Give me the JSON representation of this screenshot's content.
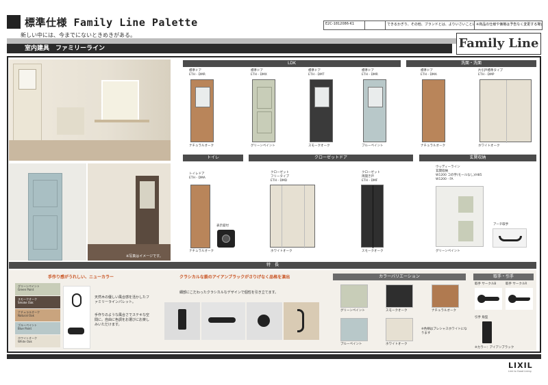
{
  "header": {
    "title": "標準仕様 Family Line Palette",
    "subtitle": "新しい中には、今までにないときめきがある。",
    "category": "室内建具　ファミリーライン",
    "logo": "Family Line",
    "info": [
      "E2C-1812086-K1",
      "",
      "できるかぎり、その他、ブランドとは、よりいさいことにも、写真の実際と、色調の異なる場合があります。",
      "※商品の仕様や価格は予告なく変更する場合があります。"
    ]
  },
  "photo": {
    "note": "※写真はイメージです。"
  },
  "sections": {
    "ldk": "LDK",
    "bath": "洗面・洗面",
    "toilet": "トイレ",
    "closet": "クローゼットドア",
    "entry": "玄関収納",
    "features": "特　長",
    "colors": "カラーバリエーション",
    "handles": "取手・引手"
  },
  "doors": [
    {
      "code": "標準ドア\nETH - DMR",
      "color": "ナチュラルオーク",
      "fill": "#b9855a"
    },
    {
      "code": "標準ドア\nETH - DMX",
      "color": "グリーンペイント",
      "fill": "#c8cdb8"
    },
    {
      "code": "標準ドア\nETH - DMT",
      "color": "スモークオーク",
      "fill": "#3a3a3a"
    },
    {
      "code": "標準ドア\nETH - DMR",
      "color": "ブルーペイント",
      "fill": "#b8c8c9"
    },
    {
      "code": "標準ドア\nETH - DMA",
      "color": "ナチュラルオーク",
      "fill": "#b9855a"
    },
    {
      "code": "片引戸標準タイプ\nETH - DMP",
      "color": "ホワイトオーク",
      "fill": "#e6e0d2"
    }
  ],
  "toilet": {
    "code": "トイレドア\nETH - DMA",
    "color": "ナチュラルオーク",
    "indicator": "表示錠付"
  },
  "closet": [
    {
      "code": "クローゼット\nフリータイプ\nETH - DMD",
      "color": "ホワイトオーク"
    },
    {
      "code": "クローゼット\n両開き戸\nETH - DMF",
      "color": "スモークオーク"
    }
  ],
  "entry": {
    "code": "ウッディーライン\n玄関収納\nW1200 コの字(モールなし)/H85\nW1200 - FA",
    "color": "グリーンペイント",
    "handle": "アーチ取手"
  },
  "features": {
    "left_title": "手作り感がうれしい、ニューカラー",
    "left_text1": "天然木の優しい風合感を活かしたファミリーラインパレット。",
    "left_text2": "手作りのような風合さでステキな空間に。自由に色調をお選びにお楽しみいただけます。",
    "swatches": [
      "グリーンペイント\nGreen Paint",
      "スモークオーク\nSmoke Oak",
      "ナチュラルオーク\nNatural Oak",
      "ブルーペイント\nBlue Paint",
      "ホワイトオーク\nWhite Oak"
    ],
    "mid_title": "クラシカルな鉄のアイアンブラックがさりげなく品格を演出",
    "mid_text": "細部にこだわったクラシカルなデザインで個性を引き立てます。"
  },
  "colors": {
    "items": [
      "グリーンペイント",
      "スモークオーク",
      "ナチュラルオーク",
      "ブルーペイント",
      "ホワイトオーク"
    ],
    "note": "※色柄はプレシャスホワイトになります",
    "fills": [
      "#c8cdb8",
      "#2e2e2e",
      "#b07a50",
      "#b8c8c9",
      "#e6e0d2"
    ]
  },
  "handles": {
    "items": [
      "取手 サークルB",
      "取手 サークルR",
      "引手 角型"
    ],
    "note": "※カラー：アイアンブラック"
  },
  "footer": {
    "brand": "LIXIL",
    "tagline": "Link to Good Living"
  }
}
